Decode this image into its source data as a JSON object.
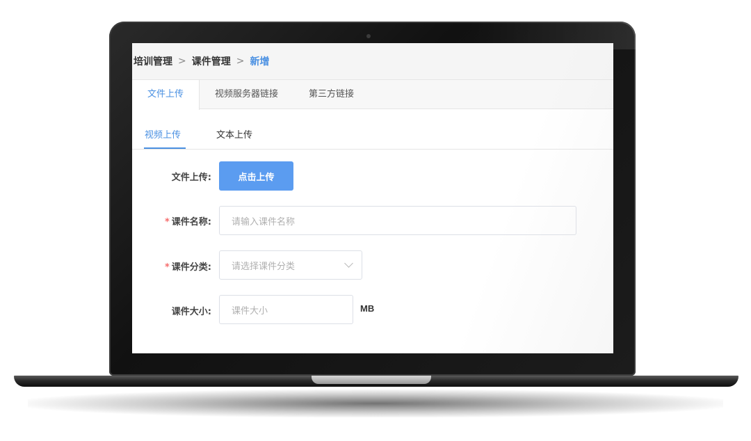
{
  "breadcrumb": {
    "items": [
      "培训管理",
      "课件管理"
    ],
    "current": "新增",
    "separator": ">"
  },
  "tabs": [
    {
      "label": "文件上传",
      "active": true
    },
    {
      "label": "视频服务器链接",
      "active": false
    },
    {
      "label": "第三方链接",
      "active": false
    }
  ],
  "subtabs": [
    {
      "label": "视频上传",
      "active": true
    },
    {
      "label": "文本上传",
      "active": false
    }
  ],
  "form": {
    "file_upload": {
      "label": "文件上传:",
      "button": "点击上传"
    },
    "course_name": {
      "required_mark": "*",
      "label": "课件名称:",
      "placeholder": "请输入课件名称"
    },
    "course_category": {
      "required_mark": "*",
      "label": "课件分类:",
      "placeholder": "请选择课件分类"
    },
    "course_size": {
      "label": "课件大小:",
      "placeholder": "课件大小",
      "unit": "MB"
    }
  },
  "colors": {
    "accent": "#4a90e2",
    "button": "#5b9cf0",
    "required": "#f56c6c"
  }
}
